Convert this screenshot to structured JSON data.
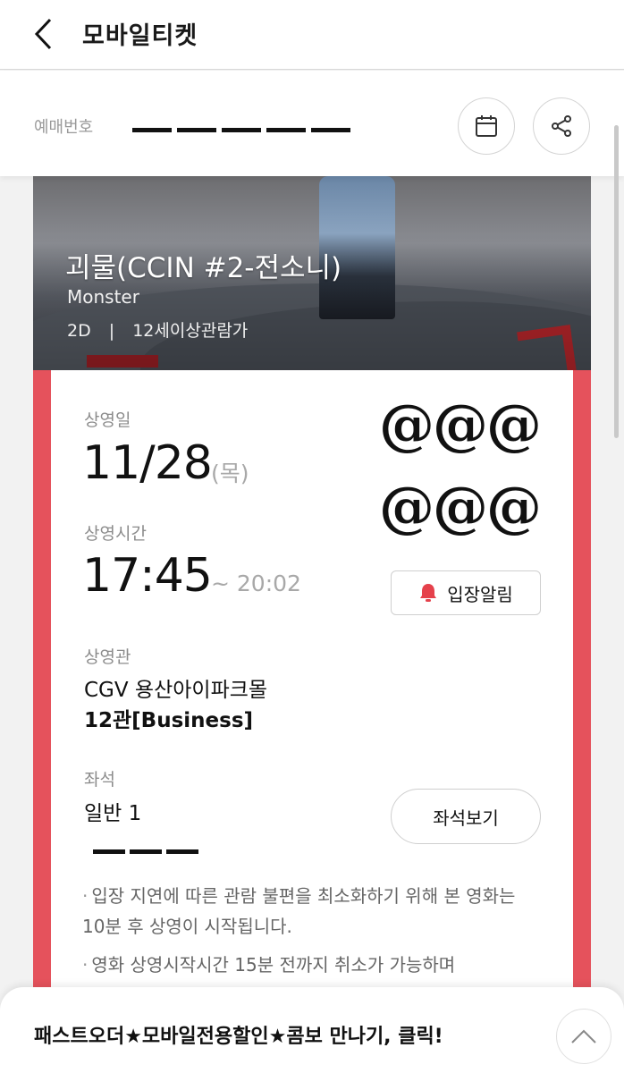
{
  "header": {
    "title": "모바일티켓"
  },
  "booking": {
    "label": "예매번호"
  },
  "movie": {
    "title": "괴물(CCIN #2-전소니)",
    "subtitle": "Monster",
    "format": "2D",
    "separator": "|",
    "rating": "12세이상관람가"
  },
  "screening": {
    "date_label": "상영일",
    "date": "11/28",
    "weekday": "(목)",
    "time_label": "상영시간",
    "start_time": "17:45",
    "end_time": "~ 20:02",
    "theater_label": "상영관",
    "theater_name": "CGV 용산아이파크몰",
    "hall": "12관[Business]",
    "seat_label": "좌석",
    "seat_value": "일반 1",
    "masked_symbols_row1": "@@@",
    "masked_symbols_row2": "@@@"
  },
  "buttons": {
    "entry_alert": "입장알림",
    "view_seat": "좌석보기"
  },
  "notices": [
    "입장 지연에 따른 관람 불편을 최소화하기 위해 본 영화는 10분 후 상영이 시작됩니다.",
    "영화 상영시작시간 15분 전까지 취소가 가능하며"
  ],
  "banner": {
    "text": "패스트오더★모바일전용할인★콤보 만나기, 클릭!"
  },
  "colors": {
    "accent": "#e5525c",
    "bell": "#e5414b"
  }
}
